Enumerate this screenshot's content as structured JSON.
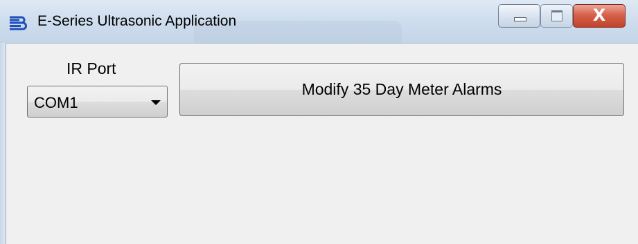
{
  "window": {
    "title": "E-Series Ultrasonic Application",
    "app_icon": "app-logo-icon",
    "controls": {
      "minimize_icon": "minimize-icon",
      "maximize_icon": "maximize-icon",
      "close_symbol": "X"
    }
  },
  "ir_port": {
    "label": "IR Port",
    "selected": "COM1",
    "dropdown_icon": "chevron-down-icon"
  },
  "actions": {
    "modify_alarms_label": "Modify 35 Day Meter Alarms"
  },
  "colors": {
    "titlebar": "#cfdeee",
    "client_background": "#f0f0f0",
    "close_button": "#d6624b",
    "app_icon": "#1f4fb8"
  }
}
